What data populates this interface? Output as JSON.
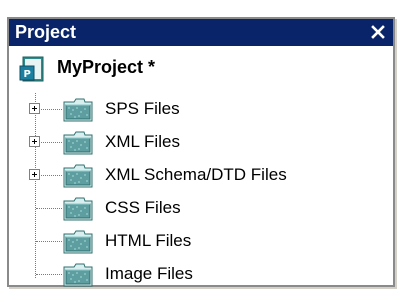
{
  "panel": {
    "title": "Project",
    "close_glyph": "✕"
  },
  "tree": {
    "root_label": "MyProject *",
    "root_icon": "project-icon",
    "items": [
      {
        "label": "SPS Files",
        "expandable": true,
        "icon": "folder-icon"
      },
      {
        "label": "XML Files",
        "expandable": true,
        "icon": "folder-icon"
      },
      {
        "label": "XML Schema/DTD Files",
        "expandable": true,
        "icon": "folder-icon"
      },
      {
        "label": "CSS Files",
        "expandable": false,
        "icon": "folder-icon"
      },
      {
        "label": "HTML Files",
        "expandable": false,
        "icon": "folder-icon"
      },
      {
        "label": "Image Files",
        "expandable": false,
        "icon": "folder-icon"
      }
    ]
  },
  "colors": {
    "titlebar": "#0a246a",
    "folder_fill": "#5f9ea0"
  }
}
